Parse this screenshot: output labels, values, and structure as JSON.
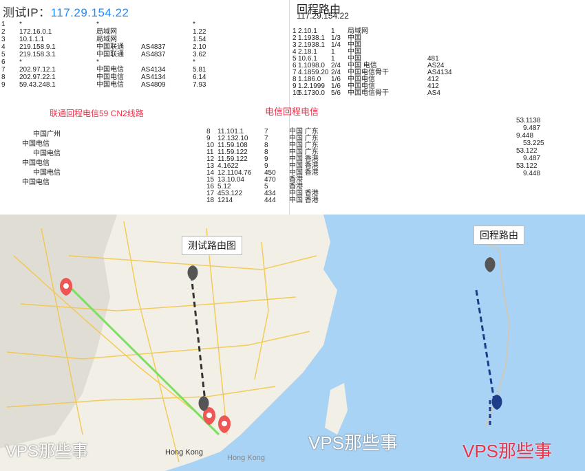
{
  "left_panel": {
    "title_label": "测试IP：",
    "title_ip": "117.29.154.22",
    "hops": [
      {
        "no": "1",
        "ip": "*",
        "host": "*",
        "as": "",
        "t": "*"
      },
      {
        "no": "2",
        "ip": "172.16.0.1",
        "host": "局域网",
        "as": "",
        "t": "1.22"
      },
      {
        "no": "3",
        "ip": "10.1.1.1",
        "host": "局域网",
        "as": "",
        "t": "1.54"
      },
      {
        "no": "4",
        "ip": "219.158.9.1",
        "host": "中国联通",
        "as": "AS4837",
        "t": "2.10"
      },
      {
        "no": "5",
        "ip": "219.158.3.1",
        "host": "中国联通",
        "as": "AS4837",
        "t": "3.62"
      },
      {
        "no": "6",
        "ip": "*",
        "host": "*",
        "as": "",
        "t": "*"
      },
      {
        "no": "7",
        "ip": "202.97.12.1",
        "host": "中国电信",
        "as": "AS4134",
        "t": "5.81"
      },
      {
        "no": "8",
        "ip": "202.97.22.1",
        "host": "中国电信",
        "as": "AS4134",
        "t": "6.14"
      },
      {
        "no": "9",
        "ip": "59.43.248.1",
        "host": "中国电信",
        "as": "AS4809",
        "t": "7.93"
      }
    ],
    "route_note": "联通回程电信59 CN2线路",
    "labels": [
      "中国广州",
      "中国电信",
      "中国电信",
      "中国电信",
      "中国电信",
      "中国电信"
    ]
  },
  "right_panel": {
    "title": "回程路由",
    "subtitle": "117.29.154.22",
    "hops": [
      {
        "no": "1",
        "ip": "2.10.1",
        "t": "1",
        "loc": "局域网",
        "as": ""
      },
      {
        "no": "2",
        "ip": "1.1938.1",
        "t": "1/3",
        "loc": "中国",
        "as": ""
      },
      {
        "no": "3",
        "ip": "2.1938.1",
        "t": "1/4",
        "loc": "中国",
        "as": ""
      },
      {
        "no": "4",
        "ip": "2.18.1",
        "t": "1",
        "loc": "中国",
        "as": ""
      },
      {
        "no": "5",
        "ip": "10.6.1",
        "t": "1",
        "loc": "中国",
        "as": "481"
      },
      {
        "no": "6",
        "ip": "1.1098.0",
        "t": "2/4",
        "loc": "中国 电信",
        "as": "AS24"
      },
      {
        "no": "7",
        "ip": "4.1859.20",
        "t": "2/4",
        "loc": "中国电信骨干",
        "as": "AS4134"
      },
      {
        "no": "8",
        "ip": "1.186.0",
        "t": "1/6",
        "loc": "中国电信",
        "as": "412"
      },
      {
        "no": "9",
        "ip": "1.2.1999",
        "t": "1/6",
        "loc": "中国电信",
        "as": "412"
      },
      {
        "no": "10",
        "ip": "5.1730.0",
        "t": "5/6",
        "loc": "中国电信骨干",
        "as": "AS4"
      }
    ],
    "route_note": "电信回程电信"
  },
  "mid_hops": [
    {
      "no": "8",
      "ip": "11.101.1",
      "t": "7",
      "loc": "中国 广东"
    },
    {
      "no": "9",
      "ip": "12.132.10",
      "t": "7",
      "loc": "中国 广东"
    },
    {
      "no": "10",
      "ip": "11.59.108",
      "t": "8",
      "loc": "中国 广东"
    },
    {
      "no": "11",
      "ip": "11.59.122",
      "t": "8",
      "loc": "中国 广东"
    },
    {
      "no": "12",
      "ip": "11.59.122",
      "t": "9",
      "loc": "中国 香港"
    },
    {
      "no": "13",
      "ip": "4.1622",
      "t": "9",
      "loc": "中国 香港"
    },
    {
      "no": "14",
      "ip": "12.1104.76",
      "t": "450",
      "loc": "中国 香港"
    },
    {
      "no": "15",
      "ip": "13.10.04",
      "t": "470",
      "loc": "香港"
    },
    {
      "no": "16",
      "ip": "5.12",
      "t": "5",
      "loc": "香港"
    },
    {
      "no": "17",
      "ip": "453.122",
      "t": "434",
      "loc": "中国 香港"
    },
    {
      "no": "18",
      "ip": "1214",
      "t": "444",
      "loc": "中国 香港"
    }
  ],
  "right_side": [
    "53.1138",
    "9.487",
    "9.448",
    "53.225",
    "53.122",
    "9.487",
    "53.122",
    "9.448"
  ],
  "map": {
    "left_tag": "测试路由图",
    "right_tag": "回程路由",
    "hk_label": "Hong Kong",
    "hk_label2": "Hong Kong",
    "watermark_left": "VPS那些事",
    "watermark_mid": "VPS那些事",
    "watermark_right": "VPS那些事"
  },
  "colors": {
    "ip_link": "#1a8cff",
    "note_red": "#e8324a",
    "route_green": "#7be060",
    "route_dark": "#333333",
    "route_blue": "#1f3c88",
    "sea": "#a9d3f5",
    "land": "#f2efe6",
    "pin_red": "#ee5555"
  }
}
